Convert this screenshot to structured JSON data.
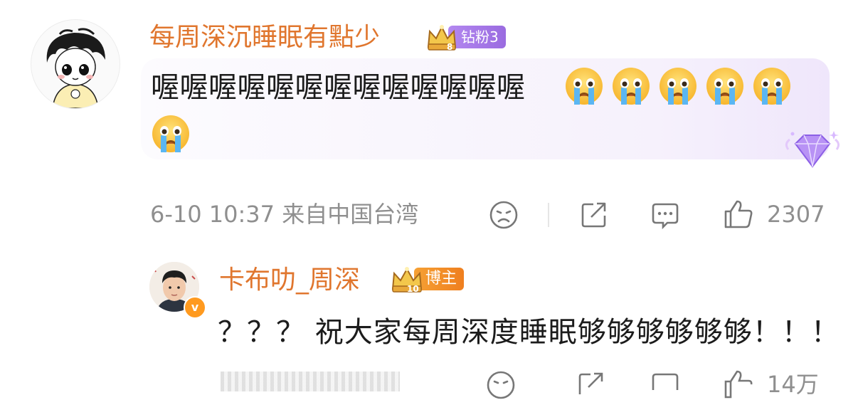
{
  "comment": {
    "username": "每周深沉睡眠有點少",
    "fan_badge": {
      "level_text": "钻粉3",
      "crown_number": "8"
    },
    "text": "喔喔喔喔喔喔喔喔喔喔喔喔喔",
    "emoji_count": 6,
    "emoji_icon": "crying-face-icon",
    "date": "6-10",
    "time": "10:37",
    "location": "来自中国台湾",
    "like_count": "2307"
  },
  "reply": {
    "username": "卡布叻_周深",
    "badge": {
      "label": "博主",
      "crown_number": "10"
    },
    "text": "？？？ 祝大家每周深度睡眠够够够够够够！！！",
    "verified_mark": "v",
    "like_count": "14万"
  },
  "colors": {
    "username": "#e0762e",
    "fan_badge": "#a87be8",
    "host_badge": "#f29029",
    "meta": "#8f8f8f",
    "bubble": "#f6f1fc"
  }
}
